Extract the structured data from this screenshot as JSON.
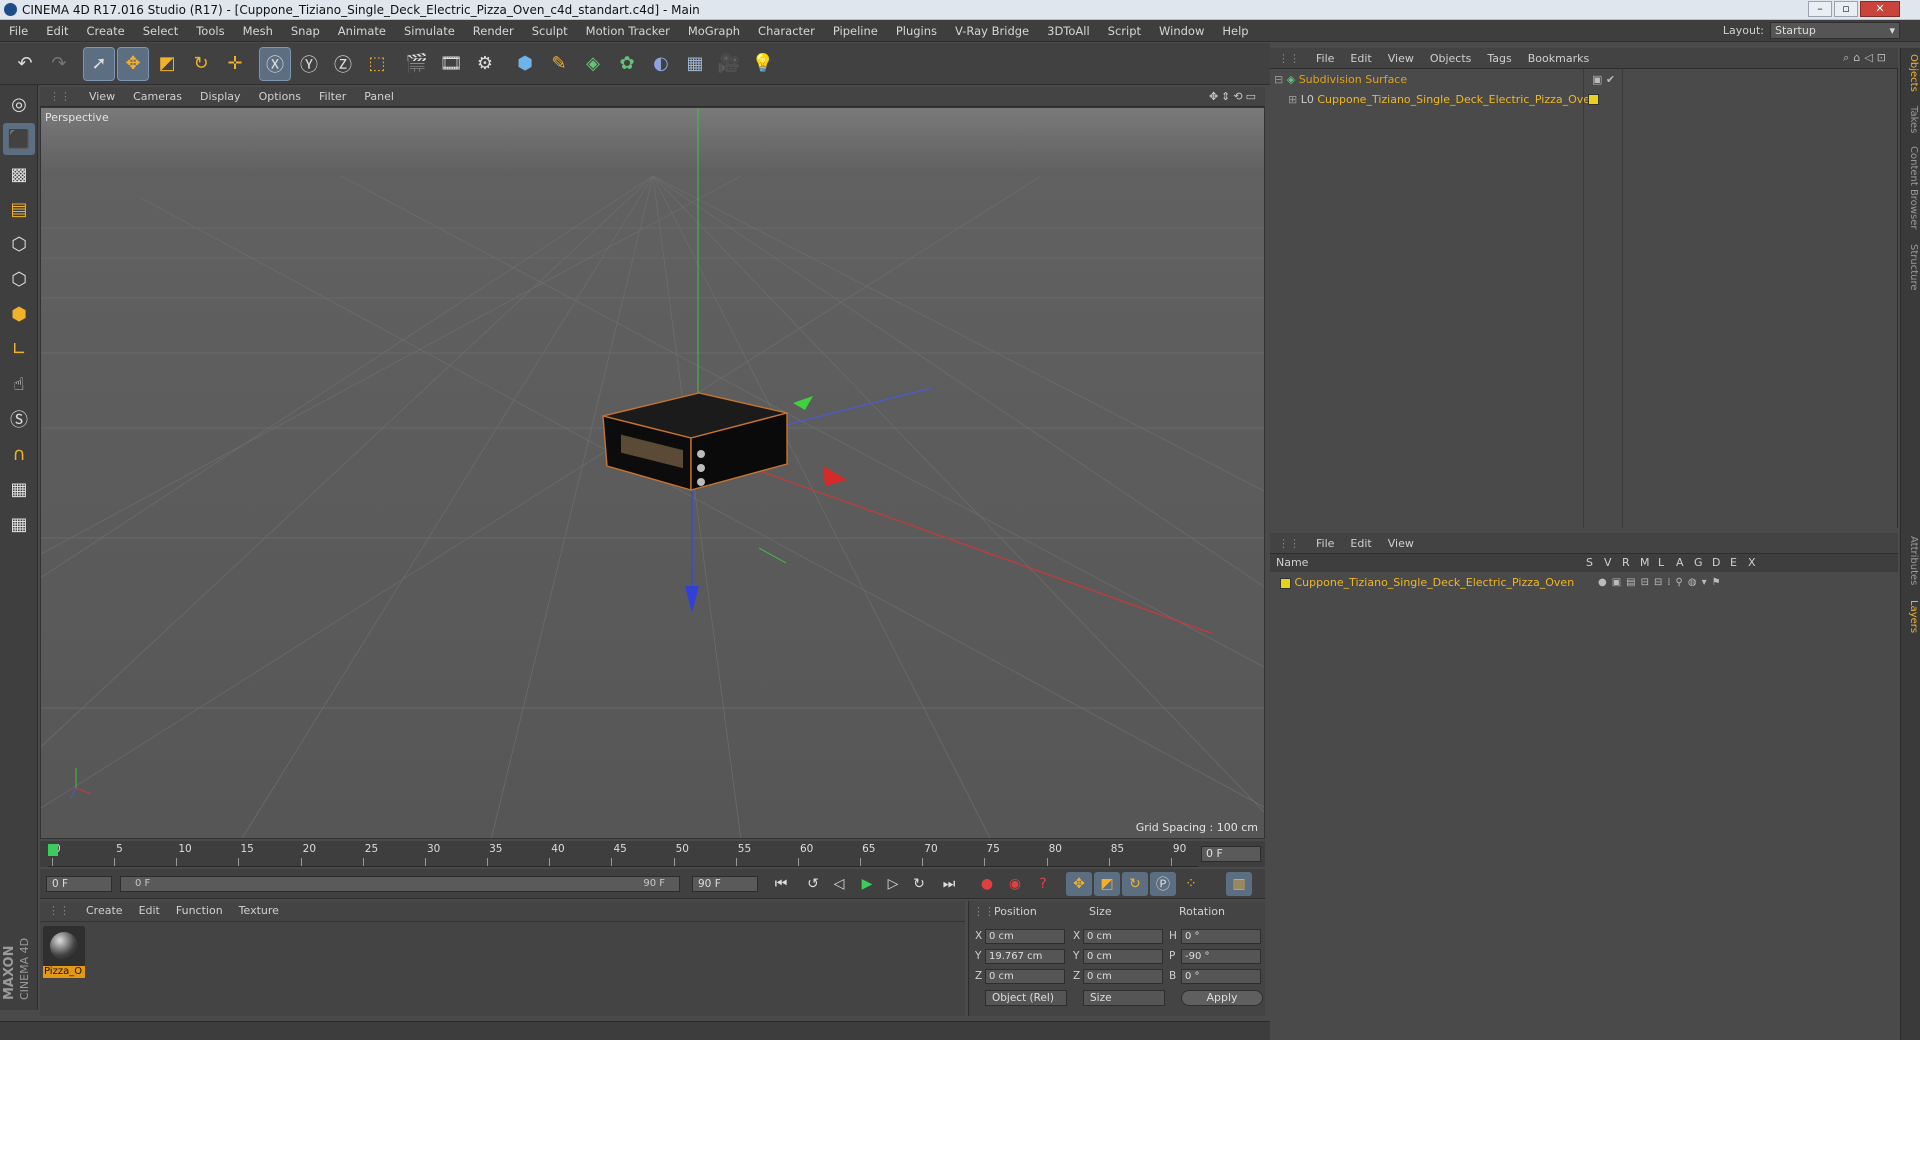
{
  "title_bar": {
    "text": "CINEMA 4D R17.016 Studio (R17) - [Cuppone_Tiziano_Single_Deck_Electric_Pizza_Oven_c4d_standart.c4d] - Main"
  },
  "menu": [
    "File",
    "Edit",
    "Create",
    "Select",
    "Tools",
    "Mesh",
    "Snap",
    "Animate",
    "Simulate",
    "Render",
    "Sculpt",
    "Motion Tracker",
    "MoGraph",
    "Character",
    "Pipeline",
    "Plugins",
    "V-Ray Bridge",
    "3DToAll",
    "Script",
    "Window",
    "Help"
  ],
  "layout": {
    "label": "Layout:",
    "value": "Startup"
  },
  "viewport": {
    "menu": [
      "View",
      "Cameras",
      "Display",
      "Options",
      "Filter",
      "Panel"
    ],
    "label": "Perspective",
    "grid_spacing": "Grid Spacing : 100 cm"
  },
  "timeline": {
    "ticks": [
      "0",
      "5",
      "10",
      "15",
      "20",
      "25",
      "30",
      "35",
      "40",
      "45",
      "50",
      "55",
      "60",
      "65",
      "70",
      "75",
      "80",
      "85",
      "90"
    ],
    "current_frame": "0 F",
    "start_field": "0 F",
    "range_start": "0 F",
    "range_end": "90 F",
    "end_field": "90 F"
  },
  "material_manager": {
    "menu": [
      "Create",
      "Edit",
      "Function",
      "Texture"
    ],
    "materials": [
      {
        "name": "Pizza_O"
      }
    ]
  },
  "coordinates": {
    "headers": {
      "position": "Position",
      "size": "Size",
      "rotation": "Rotation"
    },
    "rows": [
      {
        "axis": "X",
        "pos": "0 cm",
        "size_axis": "X",
        "size": "0 cm",
        "rot_axis": "H",
        "rot": "0 °"
      },
      {
        "axis": "Y",
        "pos": "19.767 cm",
        "size_axis": "Y",
        "size": "0 cm",
        "rot_axis": "P",
        "rot": "-90 °"
      },
      {
        "axis": "Z",
        "pos": "0 cm",
        "size_axis": "Z",
        "size": "0 cm",
        "rot_axis": "B",
        "rot": "0 °"
      }
    ],
    "mode_dropdown": "Object (Rel)",
    "size_dropdown": "Size",
    "apply_label": "Apply"
  },
  "object_manager": {
    "menu": [
      "File",
      "Edit",
      "View",
      "Objects",
      "Tags",
      "Bookmarks"
    ],
    "objects": [
      {
        "name": "Subdivision Surface",
        "color": "#e0a21c"
      },
      {
        "name": "Cuppone_Tiziano_Single_Deck_Electric_Pizza_Oven",
        "color": "#f0b820"
      }
    ]
  },
  "layer_manager": {
    "menu": [
      "File",
      "Edit",
      "View"
    ],
    "columns": [
      "Name",
      "S",
      "V",
      "R",
      "M",
      "L",
      "A",
      "G",
      "D",
      "E",
      "X"
    ],
    "layers": [
      {
        "name": "Cuppone_Tiziano_Single_Deck_Electric_Pizza_Oven",
        "color": "#f0b820"
      }
    ]
  },
  "right_tabs": [
    "Objects",
    "Takes",
    "Content Browser",
    "Structure",
    "Attributes",
    "Layers"
  ],
  "logo": {
    "line1": "MAXON",
    "line2": "CINEMA 4D"
  },
  "colors": {
    "accent_orange": "#e59812",
    "selected_blue": "#5c6e82",
    "object_yellow": "#f0b820"
  }
}
